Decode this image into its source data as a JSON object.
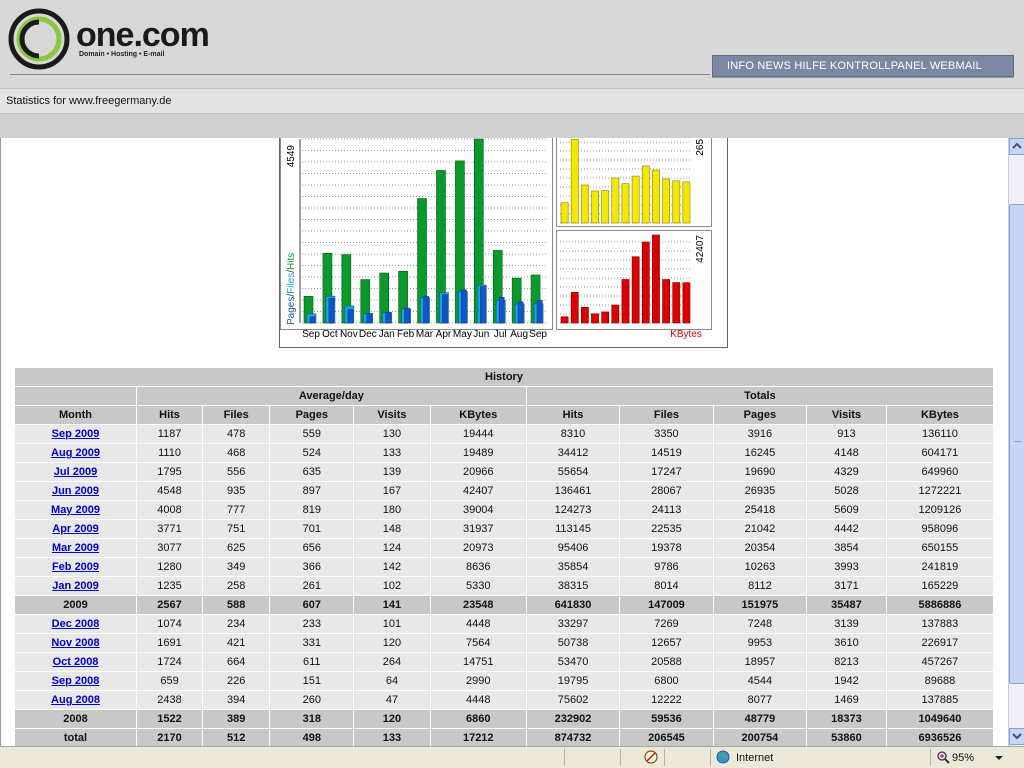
{
  "header": {
    "logo_name": "one.com",
    "logo_tagline": "Domain • Hosting • E-mail",
    "nav_label": "INFO NEWS HILFE KONTROLLPANEL WEBMAIL"
  },
  "stats_title": "Statistics for www.freegermany.de",
  "chart_data": [
    {
      "type": "bar",
      "categories": [
        "Sep",
        "Oct",
        "Nov",
        "Dec",
        "Jan",
        "Feb",
        "Mar",
        "Apr",
        "May",
        "Jun",
        "Jul",
        "Aug",
        "Sep"
      ],
      "ylabel": "Pages/Files/Hits",
      "ymax_label": "4549",
      "series": [
        {
          "name": "Hits",
          "values": [
            659,
            1724,
            1691,
            1074,
            1235,
            1280,
            3077,
            3771,
            4008,
            4548,
            1795,
            1110,
            1187
          ]
        },
        {
          "name": "Files",
          "values": [
            226,
            664,
            421,
            234,
            258,
            349,
            625,
            751,
            777,
            935,
            556,
            468,
            478
          ]
        },
        {
          "name": "Pages",
          "values": [
            151,
            611,
            331,
            233,
            261,
            366,
            656,
            701,
            819,
            897,
            635,
            524,
            559
          ]
        }
      ],
      "colors": {
        "Hits": "#0a9a2c",
        "Files": "#1aa3e6",
        "Pages": "#1155cc"
      }
    },
    {
      "type": "bar",
      "ymax_label": "265",
      "series": [
        {
          "name": "Visits",
          "values": [
            64,
            264,
            120,
            101,
            102,
            142,
            124,
            148,
            180,
            167,
            139,
            133,
            130
          ]
        }
      ],
      "colors": {
        "Visits": "#f4e800"
      }
    },
    {
      "type": "bar",
      "ymax_label": "42407",
      "xlabel": "KBytes",
      "series": [
        {
          "name": "KBytes",
          "values": [
            2990,
            14751,
            7564,
            4448,
            5330,
            8636,
            20973,
            31937,
            39004,
            42407,
            20966,
            19489,
            19444
          ]
        }
      ],
      "colors": {
        "KBytes": "#dd0000"
      }
    }
  ],
  "history": {
    "title": "History",
    "group_avg": "Average/day",
    "group_totals": "Totals",
    "col_month": "Month",
    "cols": [
      "Hits",
      "Files",
      "Pages",
      "Visits",
      "KBytes",
      "Hits",
      "Files",
      "Pages",
      "Visits",
      "KBytes"
    ],
    "rows": [
      {
        "kind": "month",
        "label": "Sep 2009",
        "cells": [
          "1187",
          "478",
          "559",
          "130",
          "19444",
          "8310",
          "3350",
          "3916",
          "913",
          "136110"
        ]
      },
      {
        "kind": "month",
        "label": "Aug 2009",
        "cells": [
          "1110",
          "468",
          "524",
          "133",
          "19489",
          "34412",
          "14519",
          "16245",
          "4148",
          "604171"
        ]
      },
      {
        "kind": "month",
        "label": "Jul 2009",
        "cells": [
          "1795",
          "556",
          "635",
          "139",
          "20966",
          "55654",
          "17247",
          "19690",
          "4329",
          "649960"
        ]
      },
      {
        "kind": "month",
        "label": "Jun 2009",
        "cells": [
          "4548",
          "935",
          "897",
          "167",
          "42407",
          "136461",
          "28067",
          "26935",
          "5028",
          "1272221"
        ]
      },
      {
        "kind": "month",
        "label": "May 2009",
        "cells": [
          "4008",
          "777",
          "819",
          "180",
          "39004",
          "124273",
          "24113",
          "25418",
          "5609",
          "1209126"
        ]
      },
      {
        "kind": "month",
        "label": "Apr 2009",
        "cells": [
          "3771",
          "751",
          "701",
          "148",
          "31937",
          "113145",
          "22535",
          "21042",
          "4442",
          "958096"
        ]
      },
      {
        "kind": "month",
        "label": "Mar 2009",
        "cells": [
          "3077",
          "625",
          "656",
          "124",
          "20973",
          "95406",
          "19378",
          "20354",
          "3854",
          "650155"
        ]
      },
      {
        "kind": "month",
        "label": "Feb 2009",
        "cells": [
          "1280",
          "349",
          "366",
          "142",
          "8636",
          "35854",
          "9786",
          "10263",
          "3993",
          "241819"
        ]
      },
      {
        "kind": "month",
        "label": "Jan 2009",
        "cells": [
          "1235",
          "258",
          "261",
          "102",
          "5330",
          "38315",
          "8014",
          "8112",
          "3171",
          "165229"
        ]
      },
      {
        "kind": "year",
        "label": "2009",
        "cells": [
          "2567",
          "588",
          "607",
          "141",
          "23548",
          "641830",
          "147009",
          "151975",
          "35487",
          "5886886"
        ]
      },
      {
        "kind": "month",
        "label": "Dec 2008",
        "cells": [
          "1074",
          "234",
          "233",
          "101",
          "4448",
          "33297",
          "7269",
          "7248",
          "3139",
          "137883"
        ]
      },
      {
        "kind": "month",
        "label": "Nov 2008",
        "cells": [
          "1691",
          "421",
          "331",
          "120",
          "7564",
          "50738",
          "12657",
          "9953",
          "3610",
          "226917"
        ]
      },
      {
        "kind": "month",
        "label": "Oct 2008",
        "cells": [
          "1724",
          "664",
          "611",
          "264",
          "14751",
          "53470",
          "20588",
          "18957",
          "8213",
          "457267"
        ]
      },
      {
        "kind": "month",
        "label": "Sep 2008",
        "cells": [
          "659",
          "226",
          "151",
          "64",
          "2990",
          "19795",
          "6800",
          "4544",
          "1942",
          "89688"
        ]
      },
      {
        "kind": "month",
        "label": "Aug 2008",
        "cells": [
          "2438",
          "394",
          "260",
          "47",
          "4448",
          "75602",
          "12222",
          "8077",
          "1469",
          "137885"
        ]
      },
      {
        "kind": "year",
        "label": "2008",
        "cells": [
          "1522",
          "389",
          "318",
          "120",
          "6860",
          "232902",
          "59536",
          "48779",
          "18373",
          "1049640"
        ]
      },
      {
        "kind": "total",
        "label": "total",
        "cells": [
          "2170",
          "512",
          "498",
          "133",
          "17212",
          "874732",
          "206545",
          "200754",
          "53860",
          "6936526"
        ]
      }
    ]
  },
  "statusbar": {
    "zone": "Internet",
    "zoom": "95%"
  },
  "icons": {
    "globe": "globe-icon",
    "zoom": "zoom-icon",
    "scroll_up": "chevron-up-icon",
    "scroll_down": "chevron-down-icon"
  }
}
